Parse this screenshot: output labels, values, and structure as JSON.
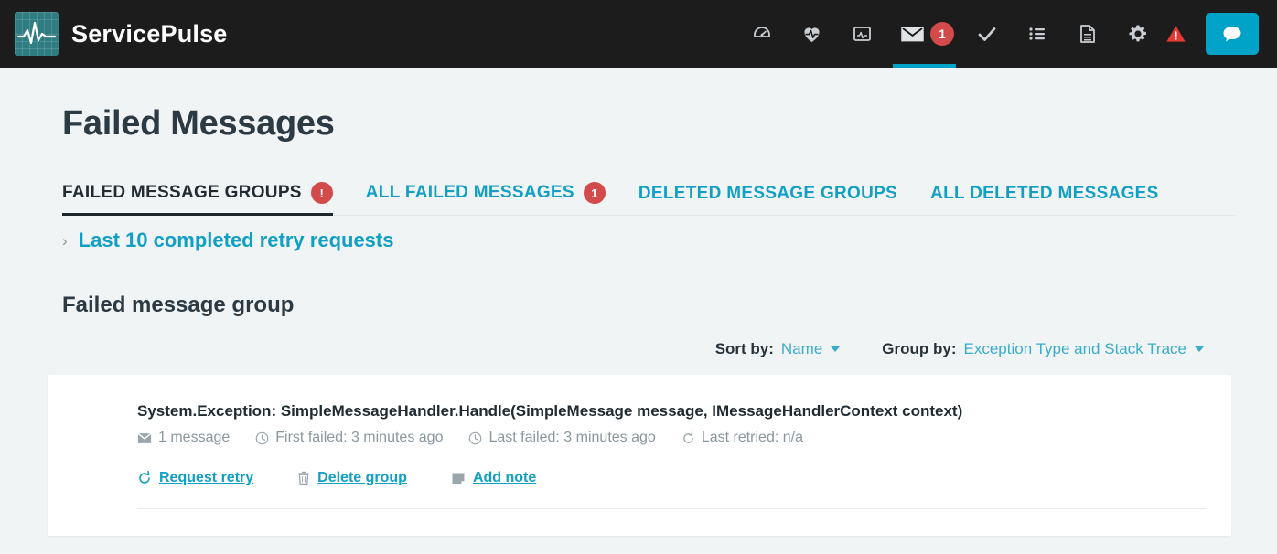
{
  "brand": {
    "name": "ServicePulse",
    "logo_icon": "pulse-waveform-icon"
  },
  "topnav": {
    "items": [
      {
        "icon": "dashboard-gauge-icon",
        "name": "dashboard"
      },
      {
        "icon": "heart-pulse-icon",
        "name": "heartbeats"
      },
      {
        "icon": "monitoring-chart-icon",
        "name": "monitoring"
      },
      {
        "icon": "envelope-icon",
        "name": "failed-messages",
        "badge": "1",
        "active": true
      },
      {
        "icon": "check-icon",
        "name": "custom-checks"
      },
      {
        "icon": "list-icon",
        "name": "events"
      },
      {
        "icon": "document-icon",
        "name": "documentation"
      },
      {
        "icon": "gear-icon",
        "name": "configuration"
      },
      {
        "icon": "warning-triangle-icon",
        "name": "alerts"
      }
    ],
    "chat": {
      "icon": "speech-bubble-icon",
      "label": ""
    },
    "active_indicator_color": "#00a3c8",
    "badge_color": "#d24a4a"
  },
  "page": {
    "title": "Failed Messages"
  },
  "tabs": [
    {
      "label": "FAILED MESSAGE GROUPS",
      "badge": "!",
      "active": true
    },
    {
      "label": "ALL FAILED MESSAGES",
      "badge": "1",
      "active": false
    },
    {
      "label": "DELETED MESSAGE GROUPS",
      "badge": "",
      "active": false
    },
    {
      "label": "ALL DELETED MESSAGES",
      "badge": "",
      "active": false
    }
  ],
  "accordion": {
    "label": "Last 10 completed retry requests",
    "chevron": "›",
    "expanded": false
  },
  "section": {
    "title": "Failed message group"
  },
  "controls": {
    "sort": {
      "label": "Sort by:",
      "value": "Name"
    },
    "group": {
      "label": "Group by:",
      "value": "Exception Type and Stack Trace"
    }
  },
  "group_card": {
    "title": "System.Exception: SimpleMessageHandler.Handle(SimpleMessage message, IMessageHandlerContext context)",
    "meta": [
      {
        "icon": "envelope-icon",
        "text": "1 message"
      },
      {
        "icon": "clock-icon",
        "text": "First failed: 3 minutes ago"
      },
      {
        "icon": "clock-icon",
        "text": "Last failed: 3 minutes ago"
      },
      {
        "icon": "retry-icon",
        "text": "Last retried: n/a"
      }
    ],
    "actions": [
      {
        "icon": "retry-icon",
        "label": "Request retry"
      },
      {
        "icon": "trash-icon",
        "label": "Delete group"
      },
      {
        "icon": "note-icon",
        "label": "Add note"
      }
    ]
  },
  "colors": {
    "accent": "#11a0c4",
    "danger": "#d24a4a",
    "header_bg": "#1c1c1c",
    "page_bg": "#f1f4f5"
  }
}
